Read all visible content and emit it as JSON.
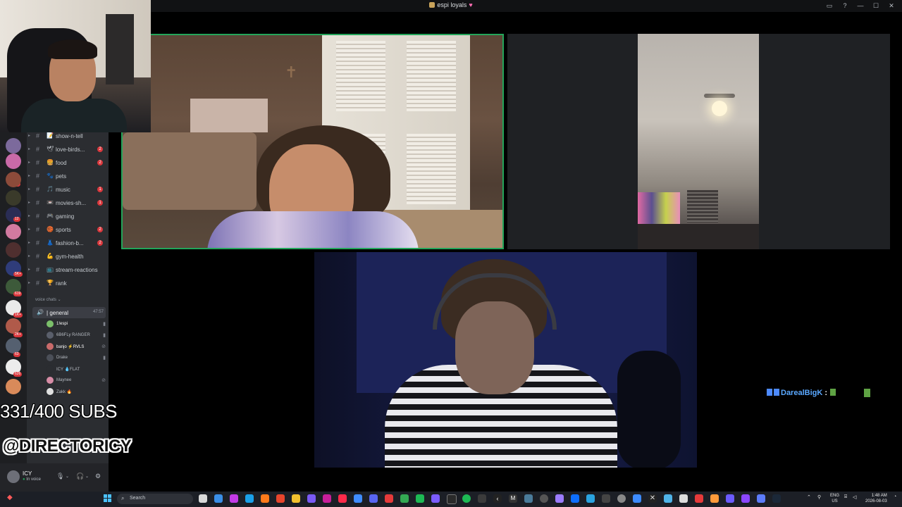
{
  "window": {
    "title": "espi loyals",
    "controls": [
      "inbox-icon",
      "help-icon",
      "minimize-icon",
      "maximize-icon",
      "close-icon"
    ]
  },
  "overlay": {
    "subs_goal": "331/400 SUBS",
    "handle": "@DIRECTORICY"
  },
  "servers": {
    "badges": [
      "27",
      "12",
      "1",
      "5K+",
      "619",
      "1K+",
      "2K+",
      "63",
      "626"
    ]
  },
  "channels": {
    "items": [
      {
        "icon": "📝",
        "label": "show-n-tell",
        "unread": ""
      },
      {
        "icon": "🕊",
        "label": "love-birds...",
        "unread": "2"
      },
      {
        "icon": "🍔",
        "label": "food",
        "unread": "2"
      },
      {
        "icon": "🐾",
        "label": "pets",
        "unread": ""
      },
      {
        "icon": "🎵",
        "label": "music",
        "unread": "1"
      },
      {
        "icon": "📼",
        "label": "movies-sh...",
        "unread": "1"
      },
      {
        "icon": "🎮",
        "label": "gaming",
        "unread": ""
      },
      {
        "icon": "🏀",
        "label": "sports",
        "unread": "2"
      },
      {
        "icon": "👗",
        "label": "fashion-b...",
        "unread": "2"
      },
      {
        "icon": "💪",
        "label": "gym-health",
        "unread": ""
      },
      {
        "icon": "📺",
        "label": "stream-reactions",
        "unread": ""
      },
      {
        "icon": "🏆",
        "label": "rank",
        "unread": ""
      }
    ],
    "voice_category": "voice chats",
    "voice_channel": {
      "label": "general",
      "time": "47:57"
    },
    "voice_users": [
      {
        "name": "1!espi",
        "color": "#7bbf6a"
      },
      {
        "name": "6B6FLy RANGER",
        "color": "#5a5f6b"
      },
      {
        "name": "banjo ⚡RVLS",
        "color": "#c96a6a"
      },
      {
        "name": "Drake",
        "color": "#4b4f58"
      },
      {
        "name": "ICY 💧FLAT",
        "color": "#2b2d31"
      },
      {
        "name": "Maynee",
        "color": "#d78ca6"
      },
      {
        "name": "Zakk 🔥",
        "color": "#e0e0e0"
      }
    ]
  },
  "user_panel": {
    "name": "ICY",
    "status": "In voice"
  },
  "chat": {
    "username": "DarealBigK",
    "separator": ":"
  },
  "taskbar": {
    "search_placeholder": "Search",
    "lang_top": "ENG",
    "lang_bottom": "US",
    "time": "1:48 AM",
    "date": "2026-08-03"
  }
}
